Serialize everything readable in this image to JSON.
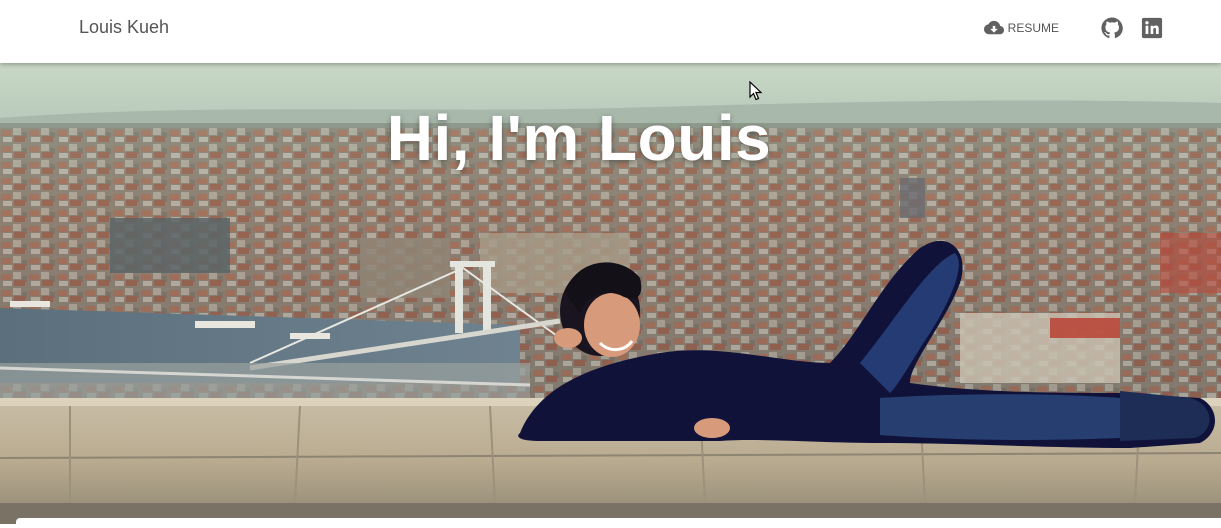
{
  "navbar": {
    "brand": "Louis Kueh",
    "resume_label": "RESUME",
    "resume_icon": "cloud-download-icon",
    "github_icon": "github-icon",
    "linkedin_icon": "linkedin-icon"
  },
  "hero": {
    "title": "Hi, I'm Louis"
  },
  "colors": {
    "nav_background": "#ffffff",
    "nav_text": "#555555",
    "hero_title": "#ffffff"
  }
}
